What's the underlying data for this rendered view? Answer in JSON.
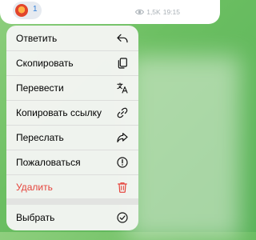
{
  "message": {
    "reaction_count": "1",
    "views": "1,5K",
    "time": "19:15"
  },
  "menu": {
    "items": [
      {
        "label": "Ответить",
        "icon": "reply-icon"
      },
      {
        "label": "Скопировать",
        "icon": "copy-icon"
      },
      {
        "label": "Перевести",
        "icon": "translate-icon"
      },
      {
        "label": "Копировать ссылку",
        "icon": "link-icon"
      },
      {
        "label": "Переслать",
        "icon": "forward-icon"
      },
      {
        "label": "Пожаловаться",
        "icon": "report-icon"
      },
      {
        "label": "Удалить",
        "icon": "trash-icon"
      }
    ],
    "select": {
      "label": "Выбрать",
      "icon": "checkmark-circle-icon"
    }
  },
  "colors": {
    "danger": "#e5433b",
    "accent": "#2f7fd8",
    "background": "#6cbf62"
  }
}
